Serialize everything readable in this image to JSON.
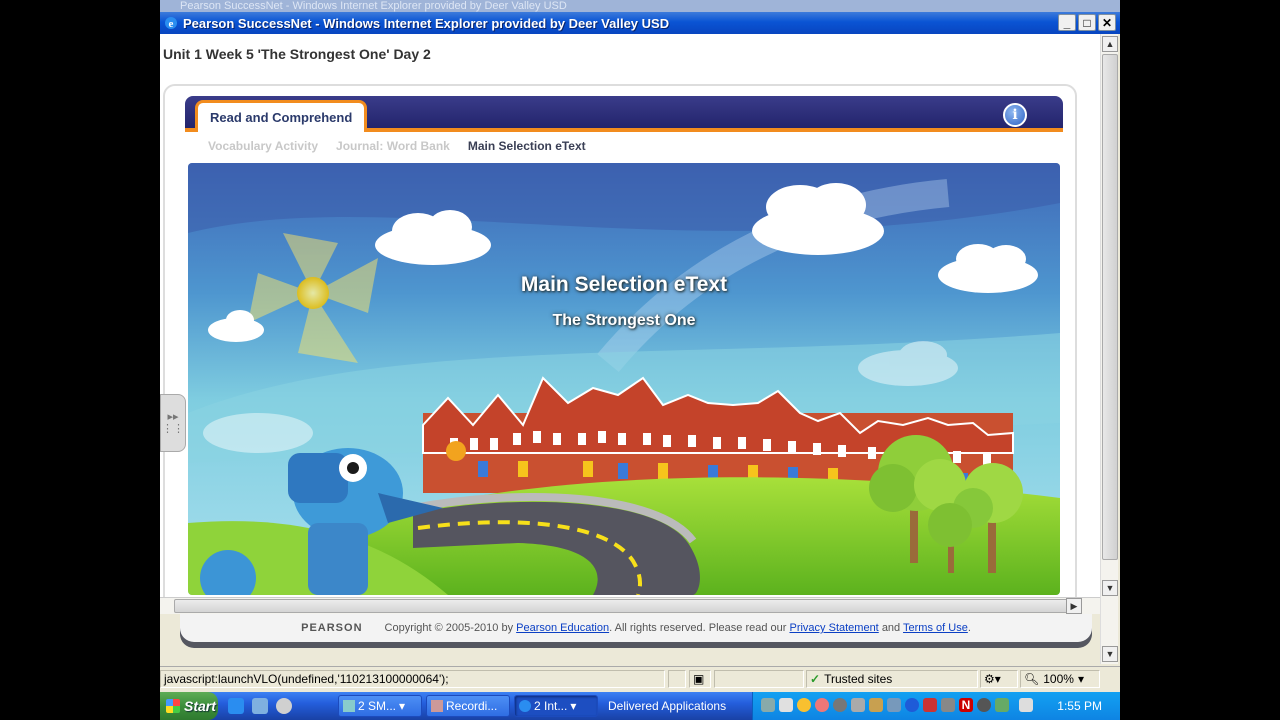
{
  "window": {
    "ghost_title": "Pearson SuccessNet - Windows Internet Explorer provided by Deer Valley USD",
    "title": "Pearson SuccessNet - Windows Internet Explorer provided by Deer Valley USD",
    "min": "_",
    "max": "□",
    "close": "✕"
  },
  "page": {
    "heading": "Unit 1 Week 5  'The Strongest One' Day 2",
    "tab_label": "Read and Comprehend",
    "info_icon": "i",
    "subtabs": [
      {
        "label": "Vocabulary Activity",
        "active": false
      },
      {
        "label": "Journal: Word Bank",
        "active": false
      },
      {
        "label": "Main Selection eText",
        "active": true
      }
    ],
    "scene": {
      "title": "Main Selection eText",
      "subtitle": "The Strongest One"
    }
  },
  "footer": {
    "logo": "PEARSON",
    "copyright": "Copyright © 2005-2010 by",
    "link1": "Pearson Education",
    "middle": ". All rights reserved. Please read our",
    "link2": "Privacy Statement",
    "and": "and",
    "link3": "Terms of Use",
    "end": "."
  },
  "statusbar": {
    "url": "javascript:launchVLO(undefined,'110213100000064');",
    "zone": "Trusted sites",
    "zoom": "100%"
  },
  "taskbar": {
    "start": "Start",
    "buttons": [
      "2 SM...",
      "Recordi...",
      "2 Int...",
      "Delivered Applications"
    ],
    "clock": "1:55 PM"
  },
  "colors": {
    "tab_accent": "#f28c1e",
    "tabbar_bg": "#2a2c78",
    "link": "#0b3fc4"
  }
}
